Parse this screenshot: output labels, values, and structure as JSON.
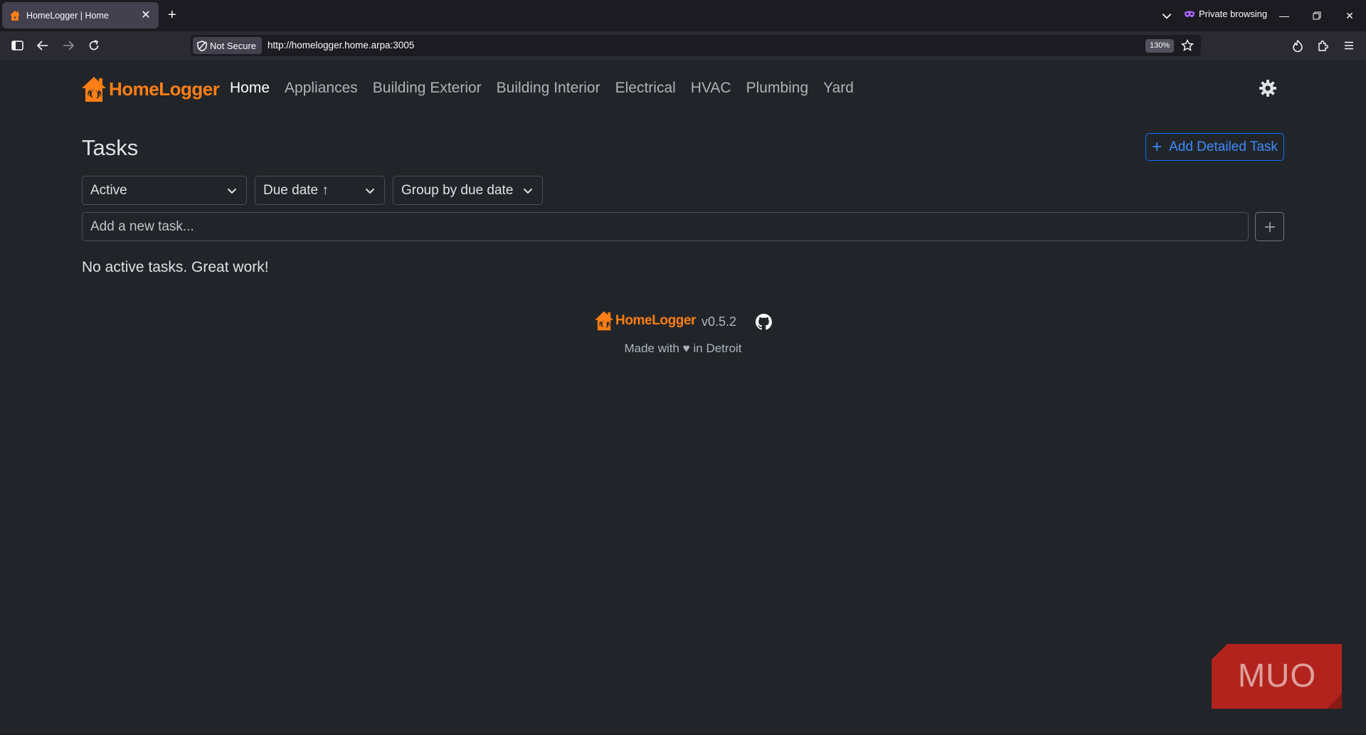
{
  "browser": {
    "tab_title": "HomeLogger | Home",
    "private_label": "Private browsing",
    "security_label": "Not Secure",
    "url": "http://homelogger.home.arpa:3005",
    "zoom": "130%"
  },
  "brand": {
    "name": "HomeLogger",
    "color": "#fd7e14"
  },
  "nav": {
    "items": [
      {
        "label": "Home",
        "active": true
      },
      {
        "label": "Appliances"
      },
      {
        "label": "Building Exterior"
      },
      {
        "label": "Building Interior"
      },
      {
        "label": "Electrical"
      },
      {
        "label": "HVAC"
      },
      {
        "label": "Plumbing"
      },
      {
        "label": "Yard"
      }
    ]
  },
  "tasks": {
    "title": "Tasks",
    "add_detailed_label": "Add Detailed Task",
    "filters": {
      "status": "Active",
      "sort": "Due date ↑",
      "group": "Group by due date"
    },
    "new_task_placeholder": "Add a new task...",
    "empty_message": "No active tasks. Great work!"
  },
  "footer": {
    "brand": "HomeLogger",
    "version": "v0.5.2",
    "made_with_prefix": "Made with",
    "heart": "♥",
    "made_with_suffix": "in Detroit"
  },
  "watermark": {
    "text": "MUO",
    "color": "#b3231d"
  },
  "colors": {
    "background": "#212529",
    "accent_blue": "#0d6efd",
    "brand_orange": "#fd7e14"
  }
}
